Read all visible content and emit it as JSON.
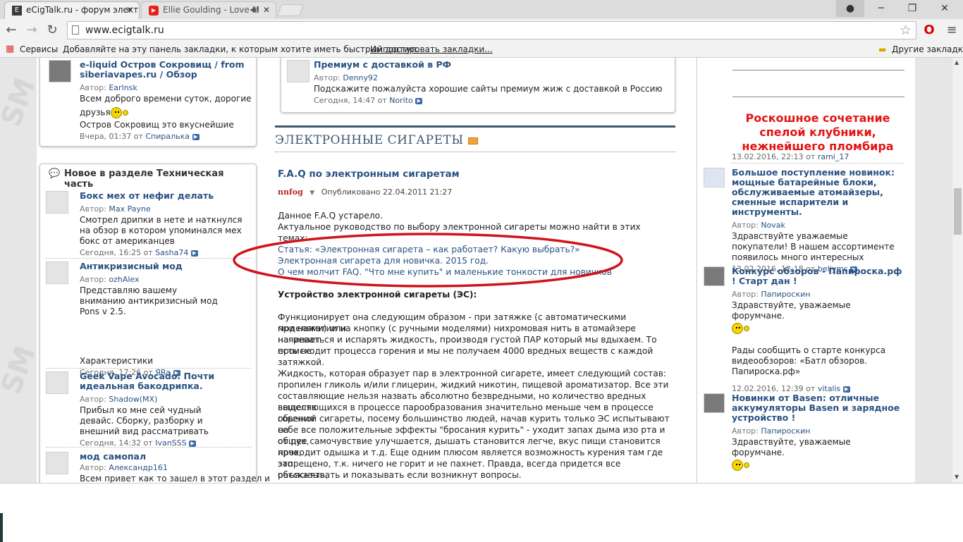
{
  "browser": {
    "tabs": [
      {
        "title": "eCigTalk.ru - форум элект",
        "favicon": "E"
      },
      {
        "title": "Ellie Goulding - Love M",
        "favicon": "▶"
      }
    ],
    "url": "www.ecigtalk.ru",
    "bookmarks": {
      "apps": "Сервисы",
      "hint": "Добавляйте на эту панель закладки, к которым хотите иметь быстрый доступ.",
      "import": "Импортировать закладки...",
      "other": "Другие закладки"
    }
  },
  "left": {
    "top_item": {
      "title_line1": "e-liquid Остров Сокровищ / from",
      "title_line2": "siberiavapes.ru / Обзор",
      "author_label": "Автор:",
      "author": "Earlnsk",
      "text1": "Всем доброго времени суток, дорогие",
      "text2": "друзья",
      "text3": "Остров Сокровищ это вкуснейшие",
      "when": "Вчера, 01:37 от",
      "when_user": "Спиралька"
    },
    "section_title": "Новое в разделе Техническая часть",
    "items": [
      {
        "title": "Бокс мех от нефиг делать",
        "author": "Max Payne",
        "text": "Смотрел дрипки в нете и наткнулся на обзор в котором упоминался мех бокс от американцев",
        "when": "Сегодня, 16:25 от",
        "user": "Sasha74"
      },
      {
        "title": "Антикризисный мод",
        "author": "ozhAlex",
        "text": "Представляю вашему вниманию антикризисный мод Pons v 2.5.",
        "extra": "Характеристики",
        "when": "Сегодня, 17:26 от",
        "user": "ЯRa"
      },
      {
        "title": "Geek Vape Avocado. Почти идеальная бакодрипка.",
        "author": "Shadow(MX)",
        "text": "Прибыл ко мне сей чудный девайс. Сборку, разборку и внешний вид рассматривать",
        "when": "Сегодня, 14:32 от",
        "user": "IvanSSS"
      },
      {
        "title": "мод самопал",
        "author": "Александр161",
        "text": "Всем привет как то зашел в этот раздел и",
        "when": "",
        "user": ""
      }
    ],
    "author_label": "Автор:"
  },
  "center": {
    "top_item": {
      "title": "Премиум с доставкой в РФ",
      "author_label": "Автор:",
      "author": "Denny92",
      "text": "Подскажите пожалуйста хорошие сайты премиум жиж с доставкой в Россию",
      "when": "Сегодня, 14:47 от",
      "user": "Norito"
    },
    "section_title": "ЭЛЕКТРОННЫЕ СИГАРЕТЫ",
    "article_title": "F.A.Q по электронным сигаретам",
    "article_author": "nnfog",
    "article_date": "Опубликовано 22.04.2011 21:27",
    "intro1": "Данное F.A.Q устарело.",
    "intro2": "Актуальное руководство по выбору электронной сигареты можно найти в этих темах:",
    "links": [
      "Статья: «Электронная сигарета – как работает? Какую выбрать?»",
      "Электронная сигарета для новичка. 2015 год.",
      "О чем молчит FAQ. \"Что мне купить\" и маленькие тонкости для новичков"
    ],
    "subhead": "Устройство электронной сигареты (ЭС):",
    "para1": [
      "Функционирует она следующим образом - при затяжке (с автоматическими моделями) или",
      "при нажатии на кнопку (с ручными моделями) нихромовая нить в атомайзере начинает",
      "нагреваться и испарять жидкость, производя густой ПАР который мы вдыхаем. То есть не",
      "происходит процесса горения и мы не получаем 4000 вредных веществ с каждой затяжкой."
    ],
    "para2": [
      "Жидкость, которая образует пар в электронной сигарете, имеет следующий состав:",
      "пропилен гликоль и/или глицерин, жидкий никотин, пищевой ароматизатор. Все эти",
      "составляющие нельзя назвать абсолютно безвредными, но количество вредных веществ",
      "выделяющихся в процессе парообразования значительно меньше чем в процессе горения",
      "обычной сигареты, посему большинство людей, начав курить только ЭС испытывают на",
      "себе все положительные эффекты \"бросания курить\" - уходит запах дыма изо рта и от рук,",
      "общее самочувствие улучшается, дышать становится легче, вкус пищи становится ярче,",
      "проходит одышка и т.д. Еще одним плюсом является возможность курения там где это",
      "запрещено, т.к. ничего не горит и не пахнет. Правда, всегда придется все объяснять,",
      "рассказывать и показывать если возникнут вопросы."
    ]
  },
  "right": {
    "promo": [
      "Роскошное сочетание",
      "спелой клубники,",
      "нежнейшего пломбира"
    ],
    "promo_when": "13.02.2016, 22:13 от",
    "promo_user": "rami_17",
    "author_label": "Автор:",
    "items": [
      {
        "title": "Большое поступление новинок: мощные батарейные блоки, обслуживаемые атомайзеры, сменные испарители и инструменты.",
        "author": "Novak",
        "text": "Здравствуйте уважаемые покупатели! В нашем ассортименте появилось много интересных",
        "when": "13.02.2016, 12:18 от",
        "user": "beliymc"
      },
      {
        "title": "Конкурс обзоров - Папироска.рф ! Старт дан !",
        "author": "Папироскин",
        "text": "Здравствуйте, уважаемые форумчане.",
        "text2": "Рады сообщить о старте конкурса видеообзоров: «Батл обзоров. Папироска.рф»",
        "when": "12.02.2016, 12:39 от",
        "user": "vitalis"
      },
      {
        "title": "Новинки от Basen: отличные аккумуляторы Basen и зарядное устройство !",
        "author": "Папироскин",
        "text": "Здравствуйте, уважаемые форумчане.",
        "when": "",
        "user": ""
      }
    ]
  },
  "colors": {
    "link": "#2a5283",
    "accent_red": "#e21414",
    "circle": "#d0141c"
  }
}
